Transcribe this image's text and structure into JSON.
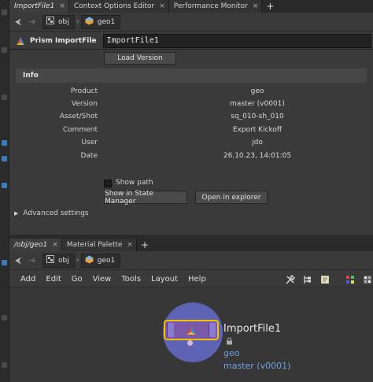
{
  "top_pane": {
    "tabs": [
      {
        "label": "ImportFile1",
        "active": true
      },
      {
        "label": "Context Options Editor",
        "active": false
      },
      {
        "label": "Performance Monitor",
        "active": false
      }
    ],
    "tab_close": "×",
    "tab_add": "+",
    "path": {
      "back": "⮜",
      "forward": "➔",
      "root": "obj",
      "child": "geo1"
    },
    "node_type_label": "Prism ImportFile",
    "node_name": "ImportFile1",
    "load_version_label": "Load Version",
    "info_header": "Info",
    "info": [
      {
        "key": "Product",
        "value": "geo"
      },
      {
        "key": "Version",
        "value": "master (v0001)"
      },
      {
        "key": "Asset/Shot",
        "value": "sq_010-sh_010"
      },
      {
        "key": "Comment",
        "value": "Export Kickoff"
      },
      {
        "key": "User",
        "value": "jdo"
      },
      {
        "key": "Date",
        "value": "26.10.23,  14:01:05"
      }
    ],
    "show_path_label": "Show path",
    "show_path_checked": false,
    "state_manager_label": "Show in State Manager",
    "explorer_label": "Open in explorer",
    "advanced_label": "Advanced settings"
  },
  "bottom_pane": {
    "tabs": [
      {
        "label": "/obj/geo1",
        "active": true
      },
      {
        "label": "Material Palette",
        "active": false
      }
    ],
    "tab_close": "×",
    "tab_add": "+",
    "path": {
      "root": "obj",
      "child": "geo1"
    },
    "menu": [
      "Add",
      "Edit",
      "Go",
      "View",
      "Tools",
      "Layout",
      "Help"
    ],
    "tool_icons": [
      "wrench-icon",
      "tree-icon",
      "notes-icon",
      "grid-icon",
      "color-palette-icon"
    ],
    "node": {
      "name": "ImportFile1",
      "product": "geo",
      "version": "master (v0001)",
      "colors": {
        "circle": "#5e63b3",
        "body": "#7a5aa8",
        "selection": "#f2c200",
        "label": "#6ea0e0"
      }
    }
  }
}
